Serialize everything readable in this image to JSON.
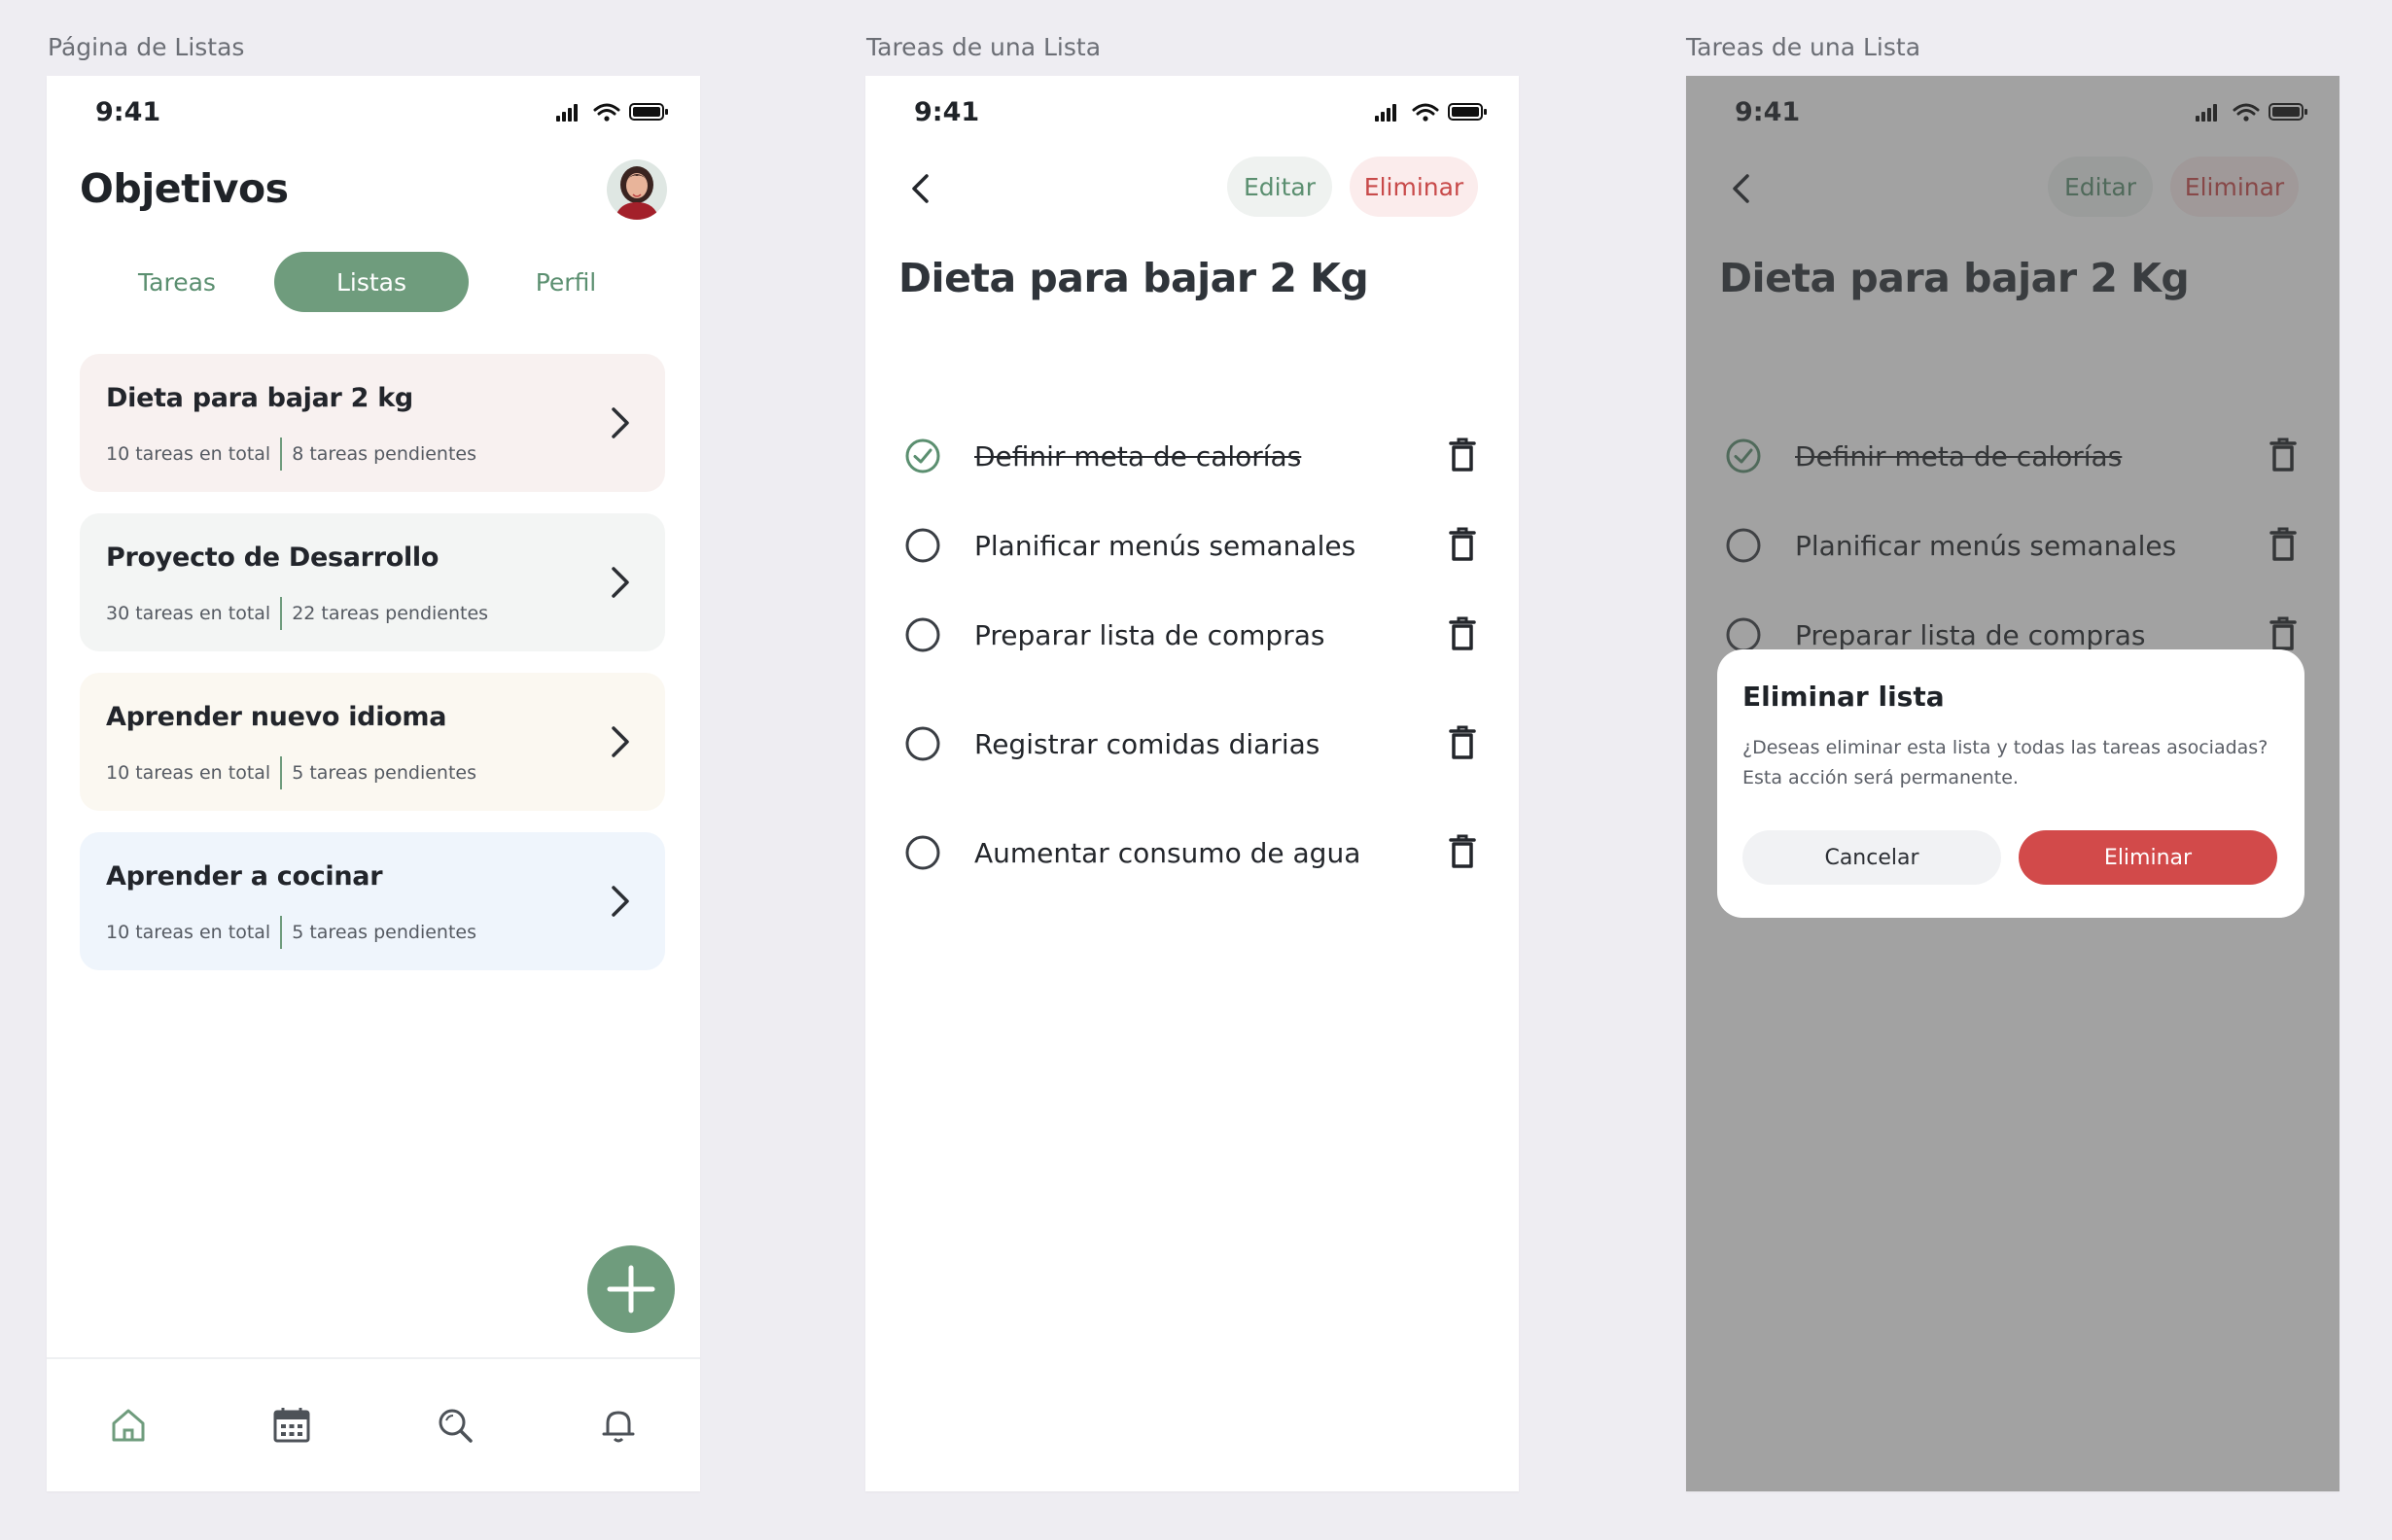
{
  "frames": [
    {
      "label": "Página de Listas"
    },
    {
      "label": "Tareas de una Lista"
    },
    {
      "label": "Tareas de una Lista"
    }
  ],
  "status_bar": {
    "time": "9:41",
    "icons": [
      "signal-icon",
      "wifi-icon",
      "battery-icon"
    ]
  },
  "lists_page": {
    "title": "Objetivos",
    "tabs": [
      {
        "label": "Tareas",
        "active": false
      },
      {
        "label": "Listas",
        "active": true
      },
      {
        "label": "Perfil",
        "active": false
      }
    ],
    "cards": [
      {
        "title": "Dieta para bajar 2 kg",
        "total": "10 tareas en total",
        "pending": "8 tareas pendientes",
        "bg": "#f8f1f0"
      },
      {
        "title": "Proyecto de Desarrollo",
        "total": "30 tareas en total",
        "pending": "22 tareas pendientes",
        "bg": "#f3f5f4"
      },
      {
        "title": "Aprender nuevo idioma",
        "total": "10 tareas en total",
        "pending": "5 tareas pendientes",
        "bg": "#fbf8f1"
      },
      {
        "title": "Aprender a cocinar",
        "total": "10 tareas en total",
        "pending": "5 tareas pendientes",
        "bg": "#eff5fc"
      }
    ],
    "fab_icon": "plus-icon",
    "bottom_nav": [
      "home-icon",
      "calendar-icon",
      "search-icon",
      "bell-icon"
    ]
  },
  "list_detail": {
    "edit_label": "Editar",
    "delete_label": "Eliminar",
    "title": "Dieta para bajar 2 Kg",
    "tasks": [
      {
        "label": "Definir meta de calorías",
        "done": true
      },
      {
        "label": "Planificar menús semanales",
        "done": false
      },
      {
        "label": "Preparar lista de compras",
        "done": false
      },
      {
        "label": "Registrar comidas diarias",
        "done": false
      },
      {
        "label": "Aumentar consumo de agua",
        "done": false
      }
    ]
  },
  "delete_dialog": {
    "title": "Eliminar lista",
    "message": "¿Deseas eliminar esta lista y todas las tareas asociadas? Esta acción será permanente.",
    "cancel_label": "Cancelar",
    "confirm_label": "Eliminar"
  },
  "colors": {
    "accent_green": "#6f9c7d",
    "danger_red": "#d24a4a"
  }
}
